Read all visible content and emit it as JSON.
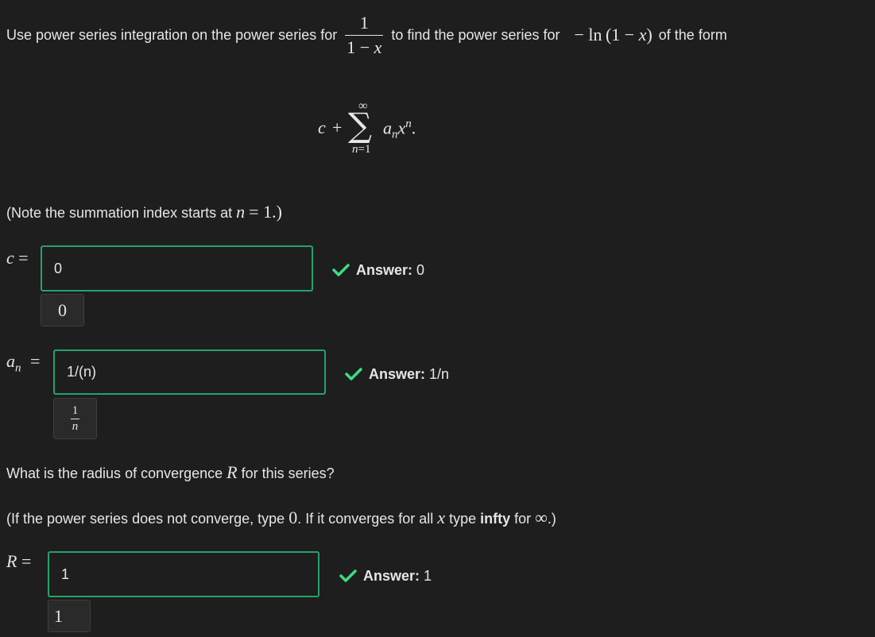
{
  "intro": {
    "text_before": "Use power series integration on the power series for",
    "frac_num": "1",
    "frac_den_a": "1 − ",
    "frac_den_x": "x",
    "text_middle": "to find the power series for",
    "target_expr_minus": "− ln",
    "target_expr_paren": "(1 − ",
    "target_expr_x": "x",
    "target_expr_close": ")",
    "text_after": "of the form"
  },
  "display_formula": {
    "c": "c",
    "plus": "+",
    "upper": "∞",
    "sigma": "∑",
    "lower": "n=1",
    "a": "a",
    "sub_n": "n",
    "x": "x",
    "sup_n": "n",
    "period": "."
  },
  "note": {
    "text_before": "(Note the summation index starts at",
    "var": "n",
    "eq": "= 1.)"
  },
  "q_c": {
    "label_var": "c",
    "label_eq": "=",
    "input_value": "0",
    "preview": "0",
    "feedback_label": "Answer:",
    "feedback_value": "0"
  },
  "q_an": {
    "label_var": "a",
    "label_sub": "n",
    "label_eq": "=",
    "input_value": "1/(n)",
    "preview_num": "1",
    "preview_den": "n",
    "feedback_label": "Answer:",
    "feedback_value": "1/n"
  },
  "radius_question": {
    "text_before": "What is the radius of convergence",
    "var": "R",
    "text_after": "for this series?"
  },
  "radius_hint": {
    "part1": "(If the power series does not converge, type",
    "zero": "0",
    "part2": ". If it converges for all",
    "var": "x",
    "part3": "type",
    "infty": "infty",
    "part4": "for",
    "inf_symbol": "∞",
    "part5": ".)"
  },
  "q_R": {
    "label_var": "R",
    "label_eq": "=",
    "input_value": "1",
    "preview": "1",
    "feedback_label": "Answer:",
    "feedback_value": "1"
  },
  "colors": {
    "background": "#1e1e1e",
    "text": "#e6e6e6",
    "correct_green": "#23a36b",
    "check_green": "#3ddc84"
  },
  "icons": {
    "check": "check-icon"
  }
}
